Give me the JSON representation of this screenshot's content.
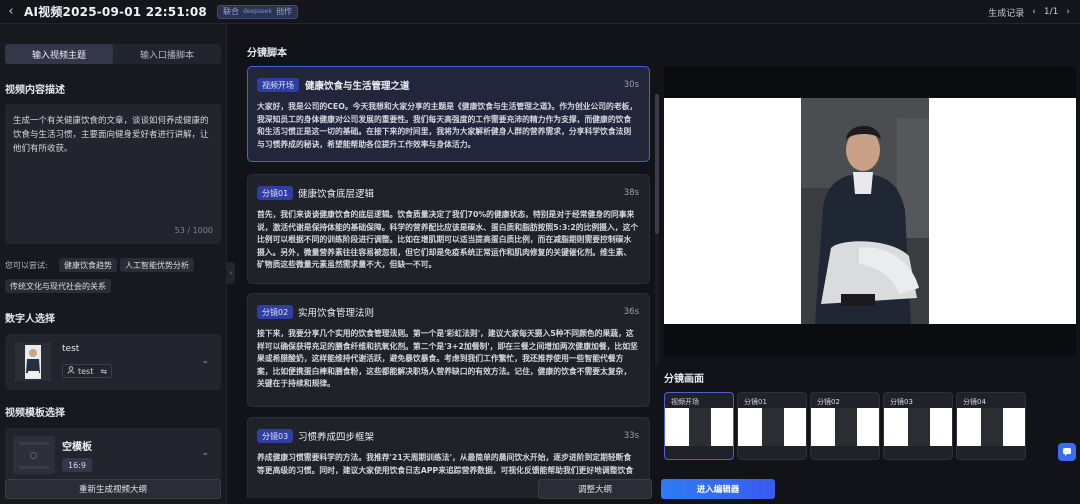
{
  "header": {
    "title": "AI视频2025-09-01 22:51:08",
    "badge_text": "联合",
    "badge_logo": "deepseek",
    "badge_suffix": "创作",
    "history_label": "生成记录",
    "pager": "1/1"
  },
  "left": {
    "tabs": [
      {
        "label": "输入视频主题",
        "active": true
      },
      {
        "label": "输入口播脚本",
        "active": false
      }
    ],
    "desc_title": "视频内容描述",
    "desc_text": "生成一个有关健康饮食的文章，谈谈如何养成健康的饮食与生活习惯，主要面向健身爱好者进行讲解，让他们有所收获。",
    "desc_count": "53 / 1000",
    "try_label": "您可以尝试:",
    "suggestions": [
      "健康饮食趋势",
      "人工智能优势分析",
      "传统文化与现代社会的关系"
    ],
    "avatar_title": "数字人选择",
    "avatar_name": "test",
    "avatar_tag": "test",
    "template_title": "视频模板选择",
    "template_name": "空模板",
    "template_ratio": "16:9",
    "regen_label": "重新生成视频大纲"
  },
  "script": {
    "title": "分镜脚本",
    "cards": [
      {
        "tag": "视频开场",
        "title": "健康饮食与生活管理之道",
        "duration": "30s",
        "active": true,
        "body": "大家好，我是公司的CEO。今天我想和大家分享的主题是《健康饮食与生活管理之道》。作为创业公司的老板，我深知员工的身体健康对公司发展的重要性。我们每天高强度的工作需要充沛的精力作为支撑，而健康的饮食和生活习惯正是这一切的基础。在接下来的时间里，我将为大家解析健身人群的营养需求，分享科学饮食法则与习惯养成的秘诀，希望能帮助各位提升工作效率与身体活力。"
      },
      {
        "tag": "分镜01",
        "title": "健康饮食底层逻辑",
        "duration": "38s",
        "active": false,
        "body": "首先，我们来谈谈健康饮食的底层逻辑。饮食质量决定了我们70%的健康状态，特别是对于经常健身的同事来说，激活代谢是保持体能的基础保障。科学的营养配比应该是碳水、蛋白质和脂肪按照5:3:2的比例摄入，这个比例可以根据不同的训练阶段进行调整。比如在增肌期可以适当提高蛋白质比例，而在减脂期则需要控制碳水摄入。另外，微量营养素往往容易被忽视，但它们却是免疫系统正常运作和肌肉修复的关键催化剂。维生素、矿物质这些微量元素虽然需求量不大，但缺一不可。"
      },
      {
        "tag": "分镜02",
        "title": "实用饮食管理法则",
        "duration": "36s",
        "active": false,
        "body": "接下来，我要分享几个实用的饮食管理法则。第一个是'彩虹法则'，建议大家每天摄入5种不同颜色的果蔬，这样可以确保获得充足的膳食纤维和抗氧化剂。第二个是'3+2加餐制'，即在三餐之间增加两次健康加餐，比如坚果或希腊酸奶，这样能维持代谢活跃，避免暴饮暴食。考虑到我们工作繁忙，我还推荐使用一些智能代餐方案，比如便携蛋白棒和膳食粉，这些都能解决职场人营养缺口的有效方法。记住，健康的饮食不需要太复杂，关键在于持续和规律。"
      },
      {
        "tag": "分镜03",
        "title": "习惯养成四步框架",
        "duration": "33s",
        "active": false,
        "body": "养成健康习惯需要科学的方法。我推荐'21天周期训练法'，从最简单的晨间饮水开始，逐步进阶到定期轻断食等更高级的习惯。同时，建议大家使用饮食日志APP来追踪营养数据，可视化反馈能帮助我们更好地调整饮食"
      }
    ]
  },
  "frames": {
    "title": "分镜画面",
    "items": [
      {
        "label": "视频开场",
        "active": true
      },
      {
        "label": "分镜01",
        "active": false
      },
      {
        "label": "分镜02",
        "active": false
      },
      {
        "label": "分镜03",
        "active": false
      },
      {
        "label": "分镜04",
        "active": false
      }
    ]
  },
  "actions": {
    "adjust_label": "调整大纲",
    "editor_label": "进入编辑器"
  },
  "colors": {
    "accent": "#4a61d6",
    "primary_button": "#2d7cf6",
    "background": "#111318"
  }
}
